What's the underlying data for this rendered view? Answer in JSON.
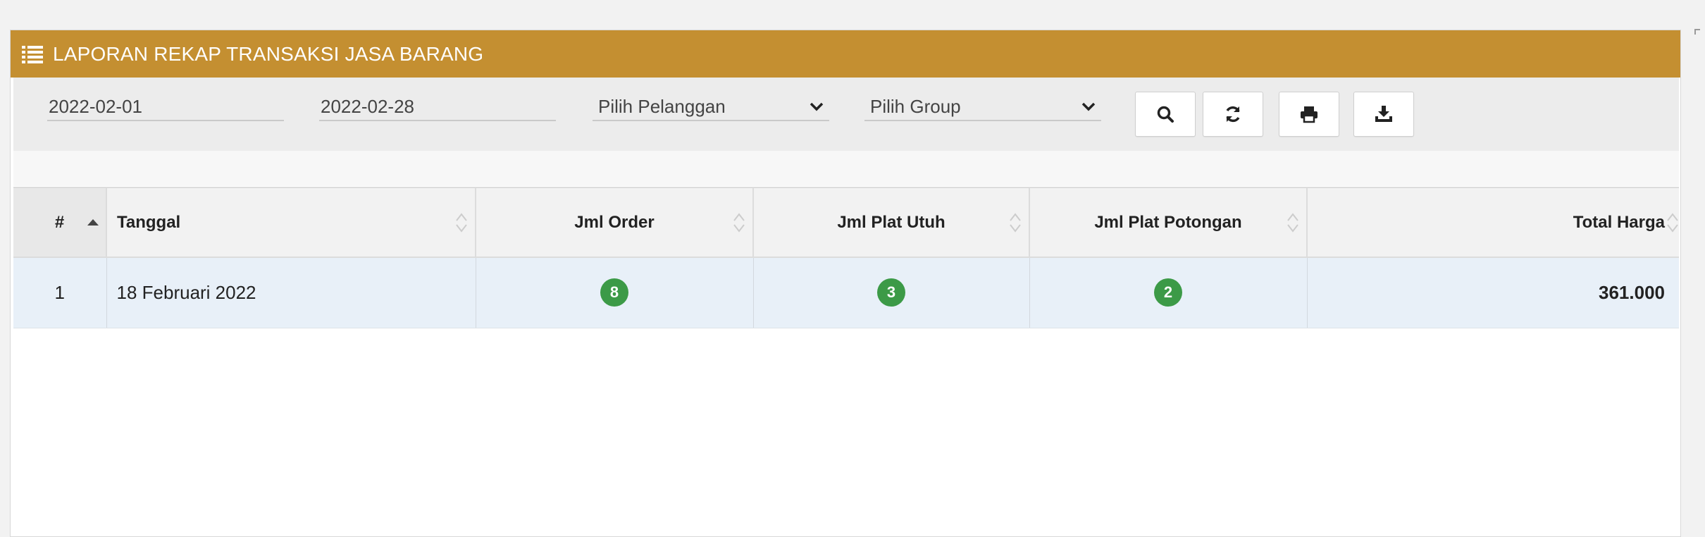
{
  "header": {
    "title": "LAPORAN REKAP TRANSAKSI JASA BARANG",
    "icon": "list-icon",
    "color": "#c48f31"
  },
  "filters": {
    "date_from": "2022-02-01",
    "date_to": "2022-02-28",
    "customer_select": "Pilih Pelanggan",
    "group_select": "Pilih Group"
  },
  "buttons": {
    "search": "search-icon",
    "refresh": "refresh-icon",
    "print": "print-icon",
    "download": "download-icon"
  },
  "table": {
    "columns": [
      "#",
      "Tanggal",
      "Jml Order",
      "Jml Plat Utuh",
      "Jml Plat Potongan",
      "Total Harga"
    ],
    "sort": {
      "column": "#",
      "direction": "ascending"
    },
    "rows": [
      {
        "no": "1",
        "tanggal": "18 Februari 2022",
        "jml_order": "8",
        "jml_plat_utuh": "3",
        "jml_plat_potongan": "2",
        "total_harga": "361.000"
      }
    ]
  },
  "badge_color": "#3c9a47"
}
